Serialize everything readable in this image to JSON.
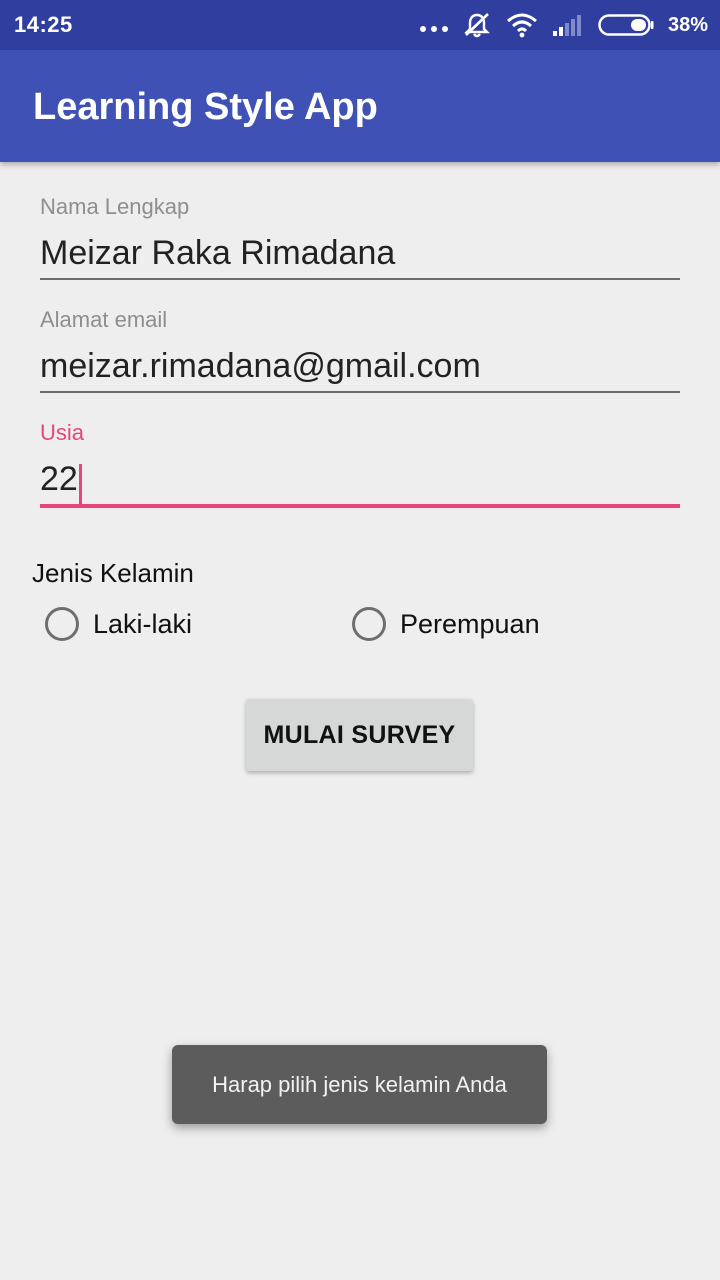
{
  "status_bar": {
    "time": "14:25",
    "battery": "38%",
    "icons": [
      "more-dots-icon",
      "silent-bell-icon",
      "wifi-icon",
      "signal-icon",
      "battery-icon"
    ]
  },
  "app_bar": {
    "title": "Learning Style App"
  },
  "form": {
    "name": {
      "label": "Nama Lengkap",
      "value": "Meizar Raka Rimadana"
    },
    "email": {
      "label": "Alamat email",
      "value": "meizar.rimadana@gmail.com"
    },
    "age": {
      "label": "Usia",
      "value": "22",
      "focused": true
    },
    "gender": {
      "label": "Jenis Kelamin",
      "options": [
        "Laki-laki",
        "Perempuan"
      ],
      "selected": null
    },
    "submit_label": "MULAI SURVEY"
  },
  "toast": {
    "message": "Harap pilih jenis kelamin Anda"
  },
  "colors": {
    "status_bar": "#303f9f",
    "app_bar": "#3f51b5",
    "accent": "#e9457a",
    "background": "#eeeeee"
  }
}
